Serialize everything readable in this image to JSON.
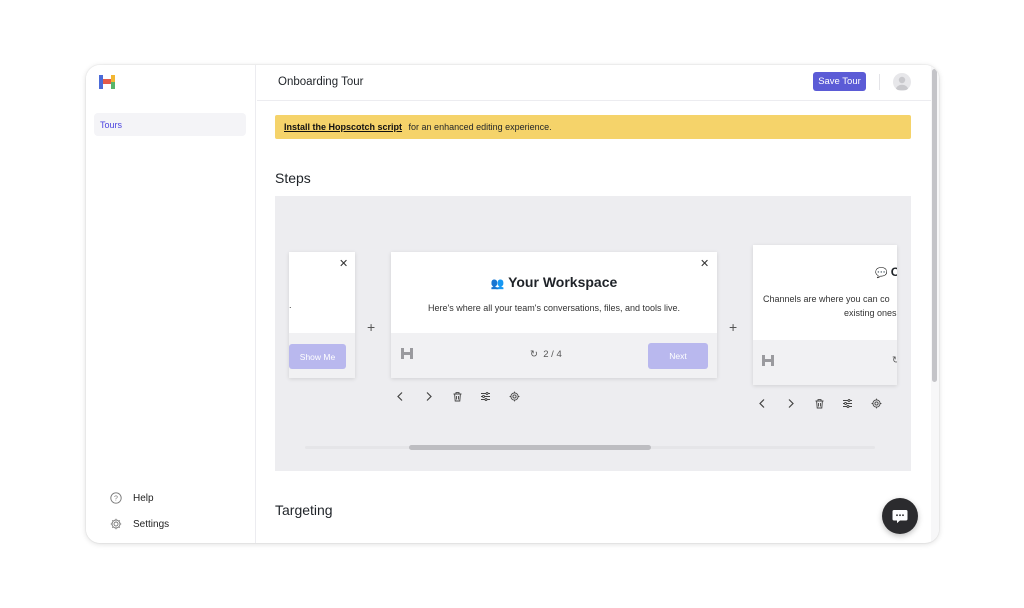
{
  "app": {
    "logo_icon": "hopscotch-logo",
    "brand_colors": [
      "#4b6bd8",
      "#e45b4b",
      "#f2b632",
      "#57b56a"
    ]
  },
  "sidebar": {
    "items": [
      {
        "label": "Tours",
        "active": true
      }
    ],
    "footer": [
      {
        "label": "Help",
        "icon": "help-circle-icon"
      },
      {
        "label": "Settings",
        "icon": "gear-icon"
      }
    ]
  },
  "header": {
    "title": "Onboarding Tour",
    "save_label": "Save Tour",
    "accent": "#5b5bd6"
  },
  "banner": {
    "link_text": "Install the Hopscotch script",
    "text": "for an enhanced editing experience.",
    "color": "#f5d36a"
  },
  "sections": {
    "steps": "Steps",
    "targeting": "Targeting"
  },
  "steps": {
    "cards": [
      {
        "title": "",
        "body": ".",
        "button": "Show Me",
        "progress": ""
      },
      {
        "emoji": "👥",
        "title": "Your Workspace",
        "body": "Here's where all your team's conversations, files, and tools live.",
        "progress": "2 / 4",
        "button": "Next"
      },
      {
        "emoji": "💬",
        "title": "C",
        "body_line1": "Channels are where you can co",
        "body_line2": "existing ones",
        "progress": ""
      }
    ],
    "toolbar_icons": [
      "chevron-left-icon",
      "chevron-right-icon",
      "trash-icon",
      "sliders-icon",
      "gear-icon"
    ]
  },
  "chat": {
    "icon": "chat-bubble-icon"
  }
}
